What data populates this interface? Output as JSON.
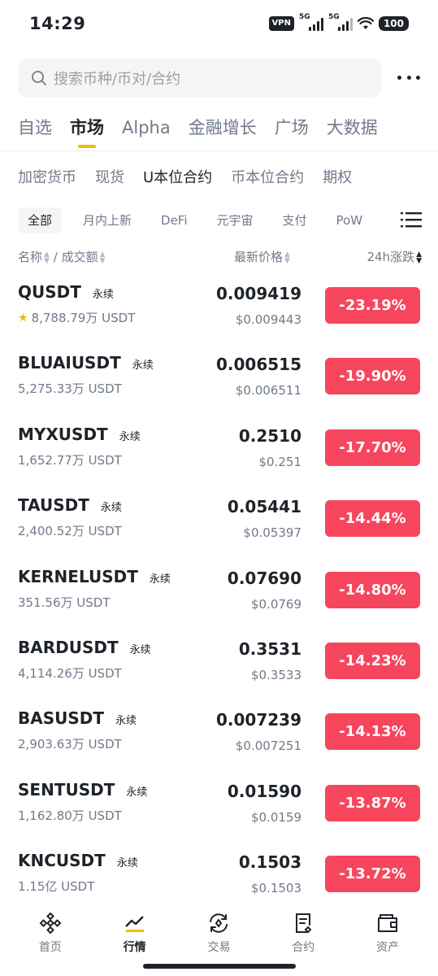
{
  "status_bar": {
    "time": "14:29",
    "vpn": "VPN",
    "sim1": "5G",
    "sim2": "5G",
    "battery": "100"
  },
  "search": {
    "placeholder": "搜索币种/币对/合约",
    "icon": "search-icon"
  },
  "main_tabs": [
    {
      "label": "自选",
      "active": false
    },
    {
      "label": "市场",
      "active": true
    },
    {
      "label": "Alpha",
      "active": false
    },
    {
      "label": "金融增长",
      "active": false
    },
    {
      "label": "广场",
      "active": false
    },
    {
      "label": "大数据",
      "active": false
    }
  ],
  "sub_tabs": [
    {
      "label": "加密货币",
      "active": false
    },
    {
      "label": "现货",
      "active": false
    },
    {
      "label": "U本位合约",
      "active": true
    },
    {
      "label": "币本位合约",
      "active": false
    },
    {
      "label": "期权",
      "active": false
    }
  ],
  "filter_chips": [
    {
      "label": "全部",
      "active": true
    },
    {
      "label": "月内上新",
      "active": false
    },
    {
      "label": "DeFi",
      "active": false
    },
    {
      "label": "元宇宙",
      "active": false
    },
    {
      "label": "支付",
      "active": false
    },
    {
      "label": "PoW",
      "active": false
    }
  ],
  "columns": {
    "name": "名称",
    "separator": "/",
    "volume": "成交额",
    "price": "最新价格",
    "change": "24h涨跌"
  },
  "rows": [
    {
      "symbol": "QUSDT",
      "type": "永续",
      "volume": "8,788.79万 USDT",
      "favorite": true,
      "price": "0.009419",
      "price_usd": "$0.009443",
      "change": "-23.19%"
    },
    {
      "symbol": "BLUAIUSDT",
      "type": "永续",
      "volume": "5,275.33万 USDT",
      "favorite": false,
      "price": "0.006515",
      "price_usd": "$0.006511",
      "change": "-19.90%"
    },
    {
      "symbol": "MYXUSDT",
      "type": "永续",
      "volume": "1,652.77万 USDT",
      "favorite": false,
      "price": "0.2510",
      "price_usd": "$0.251",
      "change": "-17.70%"
    },
    {
      "symbol": "TAUSDT",
      "type": "永续",
      "volume": "2,400.52万 USDT",
      "favorite": false,
      "price": "0.05441",
      "price_usd": "$0.05397",
      "change": "-14.44%"
    },
    {
      "symbol": "KERNELUSDT",
      "type": "永续",
      "volume": "351.56万 USDT",
      "favorite": false,
      "price": "0.07690",
      "price_usd": "$0.0769",
      "change": "-14.80%"
    },
    {
      "symbol": "BARDUSDT",
      "type": "永续",
      "volume": "4,114.26万 USDT",
      "favorite": false,
      "price": "0.3531",
      "price_usd": "$0.3533",
      "change": "-14.23%"
    },
    {
      "symbol": "BASUSDT",
      "type": "永续",
      "volume": "2,903.63万 USDT",
      "favorite": false,
      "price": "0.007239",
      "price_usd": "$0.007251",
      "change": "-14.13%"
    },
    {
      "symbol": "SENTUSDT",
      "type": "永续",
      "volume": "1,162.80万 USDT",
      "favorite": false,
      "price": "0.01590",
      "price_usd": "$0.0159",
      "change": "-13.87%"
    },
    {
      "symbol": "KNCUSDT",
      "type": "永续",
      "volume": "1.15亿 USDT",
      "favorite": false,
      "price": "0.1503",
      "price_usd": "$0.1503",
      "change": "-13.72%"
    }
  ],
  "bottom_nav": [
    {
      "label": "首页",
      "icon": "home-icon",
      "active": false
    },
    {
      "label": "行情",
      "icon": "market-chart-icon",
      "active": true
    },
    {
      "label": "交易",
      "icon": "trade-icon",
      "active": false
    },
    {
      "label": "合约",
      "icon": "futures-icon",
      "active": false
    },
    {
      "label": "资产",
      "icon": "wallet-icon",
      "active": false
    }
  ],
  "colors": {
    "accent": "#f0b90b",
    "negative": "#f6465d",
    "text_primary": "#1e2329",
    "text_secondary": "#707a8a"
  }
}
